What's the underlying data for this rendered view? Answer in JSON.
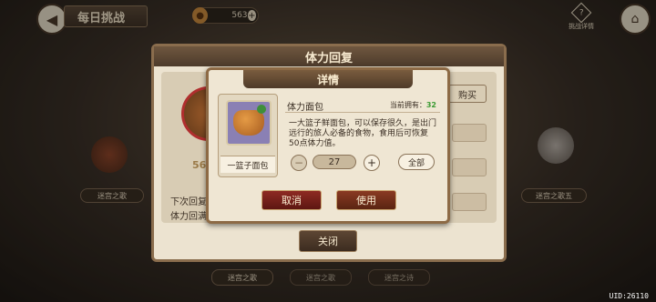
{
  "header": {
    "title": "每日挑战",
    "currency_value": "563",
    "rules_label": "挑战详情"
  },
  "background": {
    "left_label": "迷宫之歌",
    "right_label": "迷宫之歌五",
    "bottom_tabs": [
      "迷宫之歌",
      "迷宫之歌",
      "迷宫之诗"
    ],
    "stamina_value": "56.",
    "next_recover_lines": [
      "下次回复",
      "体力回满"
    ]
  },
  "outer_panel": {
    "title": "体力回复",
    "buy_label": "购买",
    "close_label": "关闭"
  },
  "detail": {
    "title": "详情",
    "item_name": "一篮子面包",
    "item_title": "体力面包",
    "own_label": "当前拥有：",
    "own_count": "32",
    "description": "一大篮子鲜面包，可以保存很久，是出门远行的旅人必备的食物，食用后可恢复50点体力值。",
    "quantity": "27",
    "all_label": "全部",
    "cancel_label": "取消",
    "use_label": "使用"
  },
  "uid": "UID:26110"
}
